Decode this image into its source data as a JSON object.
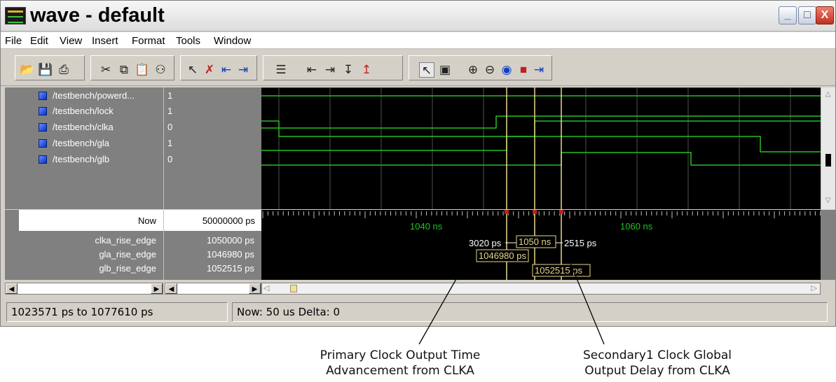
{
  "window": {
    "title": "wave - default",
    "buttons": [
      "_",
      "□",
      "X"
    ]
  },
  "menu": [
    "File",
    "Edit",
    "View",
    "Insert",
    "Format",
    "Tools",
    "Window"
  ],
  "toolbar": {
    "icons": [
      "open-icon",
      "save-icon",
      "print-icon",
      "cut-icon",
      "copy-icon",
      "paste-icon",
      "find-icon",
      "add-cursor-icon",
      "delete-cursor-icon",
      "cursor-left-icon",
      "cursor-right-icon",
      "edge-list-icon",
      "find-prev-edge-icon",
      "find-next-edge-icon",
      "find-fall-icon",
      "find-rise-icon",
      "select-mode-icon",
      "zoom-mode-icon",
      "zoom-in-icon",
      "zoom-out-icon",
      "zoom-full-icon",
      "stop-icon",
      "zoom-cursor-icon"
    ]
  },
  "signals": [
    {
      "name": "/testbench/powerd...",
      "value": "1"
    },
    {
      "name": "/testbench/lock",
      "value": "1"
    },
    {
      "name": "/testbench/clka",
      "value": "0"
    },
    {
      "name": "/testbench/gla",
      "value": "1"
    },
    {
      "name": "/testbench/glb",
      "value": "0"
    }
  ],
  "cursors": {
    "now_label": "Now",
    "now_value": "50000000 ps",
    "rows": [
      {
        "name": "clka_rise_edge",
        "value": "1050000 ps"
      },
      {
        "name": "gla_rise_edge",
        "value": "1046980 ps"
      },
      {
        "name": "glb_rise_edge",
        "value": "1052515 ps"
      }
    ]
  },
  "timeline": {
    "tick_labels": [
      "1040 ns",
      "1060 ns"
    ],
    "delta_left": "3020 ps",
    "cursor_label_center": "1050 ns",
    "delta_right": "2515 ps",
    "cursor_label_gla": "1046980 ps",
    "cursor_label_glb": "1052515 ps"
  },
  "status": {
    "range": "1023571 ps to 1077610 ps",
    "now_delta": "Now: 50 us   Delta: 0"
  },
  "captions": {
    "left": [
      "Primary Clock Output Time",
      "Advancement from CLKA"
    ],
    "right": [
      "Secondary1 Clock Global",
      "Output Delay from CLKA"
    ]
  },
  "colors": {
    "wave": "#22c022",
    "cursor": "#e8d890",
    "cursor_marker": "#c02020",
    "grid": "#505050"
  }
}
